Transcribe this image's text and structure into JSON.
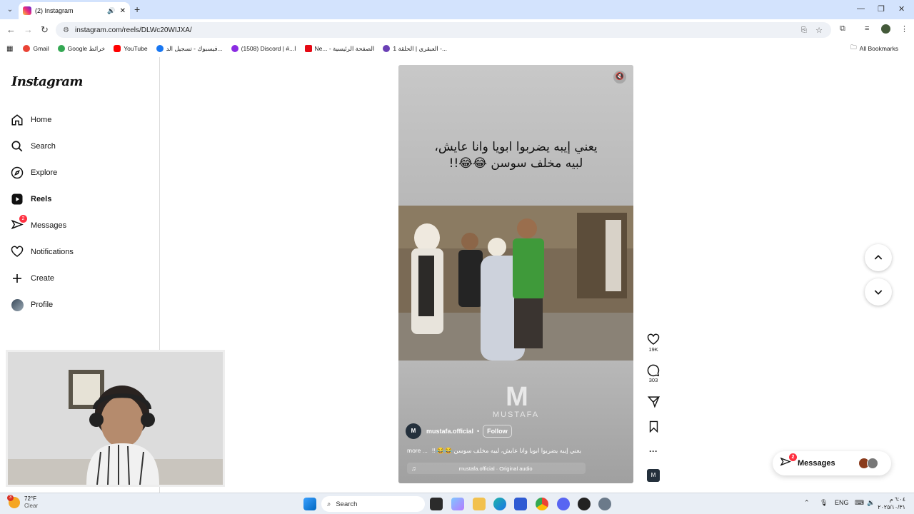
{
  "browser": {
    "tab_title": "(2) Instagram",
    "url": "instagram.com/reels/DLWc20WIJXA/",
    "bookmarks": [
      {
        "label": "Gmail",
        "color": "#ea4335"
      },
      {
        "label": "Google خرائط",
        "color": "#34a853"
      },
      {
        "label": "YouTube",
        "color": "#ff0000"
      },
      {
        "label": "فيسبوك - تسجيل الد...",
        "color": "#1877f2"
      },
      {
        "label": "(1508) Discord | #...ا",
        "color": "#8a2be2"
      },
      {
        "label": "Ne... - الصفحة الرئيسية",
        "color": "#e50914"
      },
      {
        "label": "العبقري | الحلقة 1 -...",
        "color": "#6a3fb5"
      }
    ],
    "all_bookmarks": "All Bookmarks"
  },
  "sidebar": {
    "logo": "Instagram",
    "items": [
      {
        "label": "Home",
        "icon": "home-icon"
      },
      {
        "label": "Search",
        "icon": "search-icon"
      },
      {
        "label": "Explore",
        "icon": "compass-icon"
      },
      {
        "label": "Reels",
        "icon": "reels-icon",
        "active": true
      },
      {
        "label": "Messages",
        "icon": "messenger-icon",
        "badge": "2"
      },
      {
        "label": "Notifications",
        "icon": "heart-icon"
      },
      {
        "label": "Create",
        "icon": "plus-icon"
      },
      {
        "label": "Profile",
        "icon": "avatar-icon"
      }
    ]
  },
  "reel": {
    "overlay_line1": "يعني إيبه يضربوا ابويا وانا عايش،",
    "overlay_line2": "لبيه مخلف سوسن 😂😂!!",
    "watermark": "MUSTAFA",
    "username": "mustafa.official",
    "follow": "Follow",
    "caption": "يعني إيبه يضربوا ابويا وانا عايش، لبيه مخلف سوسن 😂😂 !!",
    "more": "more ...",
    "audio": "mustafa.official · Original audio"
  },
  "actions": {
    "likes": "19K",
    "comments": "303"
  },
  "messages_pill": {
    "label": "Messages",
    "badge": "2"
  },
  "taskbar": {
    "temp": "72°F",
    "weather": "Clear",
    "weather_badge": "3",
    "search": "Search",
    "lang": "ENG",
    "time": "٦:٠٤ م",
    "date": "٢٠٢٥/١٠/٣١"
  }
}
